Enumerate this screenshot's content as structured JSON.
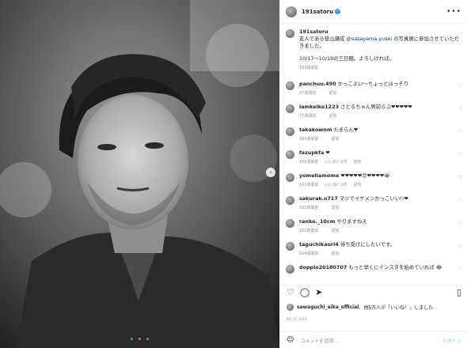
{
  "post": {
    "username": "191satoru",
    "caption_line1": "友人である笹山謙成",
    "caption_mention": "@sasayama.yusei",
    "caption_line1_rest": " の写真展に参加させていただきました。",
    "caption_line2": "10/17〜10/19の三日間。よろしければ。",
    "caption_time": "184週間前"
  },
  "comments": [
    {
      "user": "panchuu.490",
      "text": "かっこよい〜ちょっとほっそり",
      "time": "37週間前",
      "likes": "",
      "reply": "返信"
    },
    {
      "user": "iamkeiko1223",
      "text": "さとるちゃん男前らぶ❤❤❤❤❤",
      "time": "77週間前",
      "likes": "",
      "reply": "返信"
    },
    {
      "user": "takakownm",
      "text": "たまらん❤",
      "time": "160週間前",
      "likes": "",
      "reply": "返信"
    },
    {
      "user": "fazupkfa",
      "text": "❤",
      "time": "161週間前",
      "likes": "いいね！2件",
      "reply": "返信"
    },
    {
      "user": "yomellamome",
      "text": "❤❤❤❤❤😍❤❤❤❤😭",
      "time": "162週間前",
      "likes": "いいね！1件",
      "reply": "返信"
    },
    {
      "user": "sakurak.o717",
      "text": "マジでイケメンかっこいい!!❤",
      "time": "162週間前",
      "likes": "",
      "reply": "返信"
    },
    {
      "user": "ranko._10cm",
      "text": "やりますねえ",
      "time": "162週間前",
      "likes": "",
      "reply": "返信"
    },
    {
      "user": "taguchikaori4",
      "text": "待ち受けにしたいです。",
      "time": "164週間前",
      "likes": "",
      "reply": "返信"
    },
    {
      "user": "doppio20180707",
      "text": "もっと早くにインスタを始めていれば 😂",
      "time": "",
      "likes": "",
      "reply": ""
    }
  ],
  "actions": {
    "like_icon": "heart-icon",
    "comment_icon": "comment-icon",
    "share_icon": "share-icon",
    "save_icon": "bookmark-icon"
  },
  "likes_line": {
    "user": "sawaguchi_aika_official",
    "rest": "、他5万人が「いいね！」しました"
  },
  "date": "8月 17, 2019",
  "add_comment": {
    "placeholder": "コメントを追加...",
    "post": "投稿する"
  },
  "colors": {
    "accent": "#3897f0",
    "muted": "#8e8e8e"
  }
}
